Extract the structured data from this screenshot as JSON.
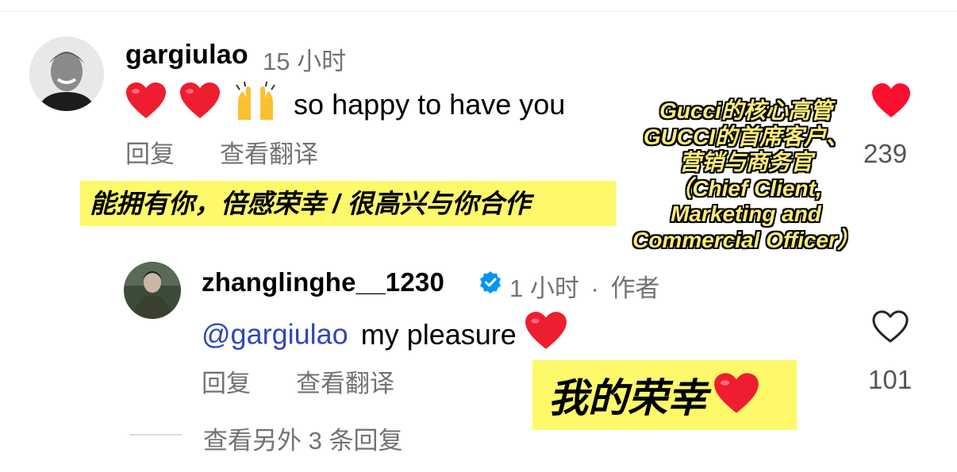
{
  "comment": {
    "username": "gargiulao",
    "time": "15 小时",
    "text": "so happy to have you",
    "emojis": [
      "red-heart",
      "red-heart",
      "raising-hands"
    ],
    "reply_label": "回复",
    "translate_label": "查看翻译",
    "likes": "239",
    "liked": true,
    "translation_highlight": "能拥有你，倍感荣幸 / 很高兴与你合作"
  },
  "annotation": {
    "lines": [
      "Gucci的核心高管",
      "GUCCI的首席客户、",
      "营销与商务官",
      "（Chief Client,",
      "Marketing and",
      "Commercial Officer）"
    ]
  },
  "reply": {
    "username": "zhanglinghe__1230",
    "verified": true,
    "time": "1 小时",
    "separator": "·",
    "author_label": "作者",
    "mention": "@gargiulao",
    "text": "my pleasure",
    "reply_label": "回复",
    "translate_label": "查看翻译",
    "likes": "101",
    "liked": false,
    "translation_highlight": "我的荣幸"
  },
  "view_more_replies": "查看另外 3 条回复",
  "colors": {
    "highlight": "#fdf96a",
    "heart_red": "#ff0f2f",
    "verified_blue": "#0095f6",
    "mention_blue": "#3247b4",
    "secondary_text": "#737373"
  }
}
